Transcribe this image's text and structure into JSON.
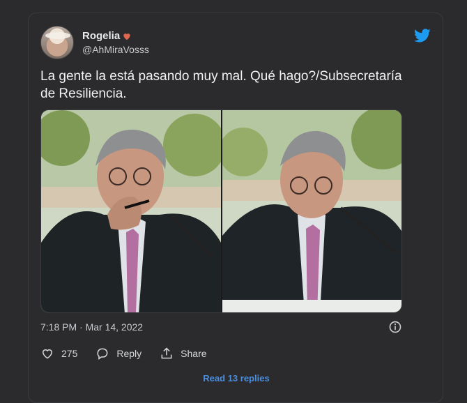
{
  "tweet": {
    "display_name": "Rogelia",
    "name_emoji": "heart-icon",
    "handle": "@AhMiraVosss",
    "text": "La gente la está pasando muy mal. Qué hago?/Subsecretaría de Resiliencia.",
    "timestamp": "7:18 PM · Mar 14, 2022",
    "likes_count": "275",
    "reply_label": "Reply",
    "share_label": "Share",
    "read_replies_label": "Read 13 replies"
  },
  "media": {
    "photo_count": 2
  },
  "colors": {
    "background": "#2b2b2d",
    "text": "#e7e9ea",
    "muted": "#c9cbce",
    "twitter_blue": "#1d9bf0",
    "link": "#4a8ee0",
    "heart": "#e0664f"
  },
  "icons": [
    "twitter-bird-icon",
    "info-icon",
    "like-heart-icon",
    "reply-bubble-icon",
    "share-upload-icon"
  ]
}
